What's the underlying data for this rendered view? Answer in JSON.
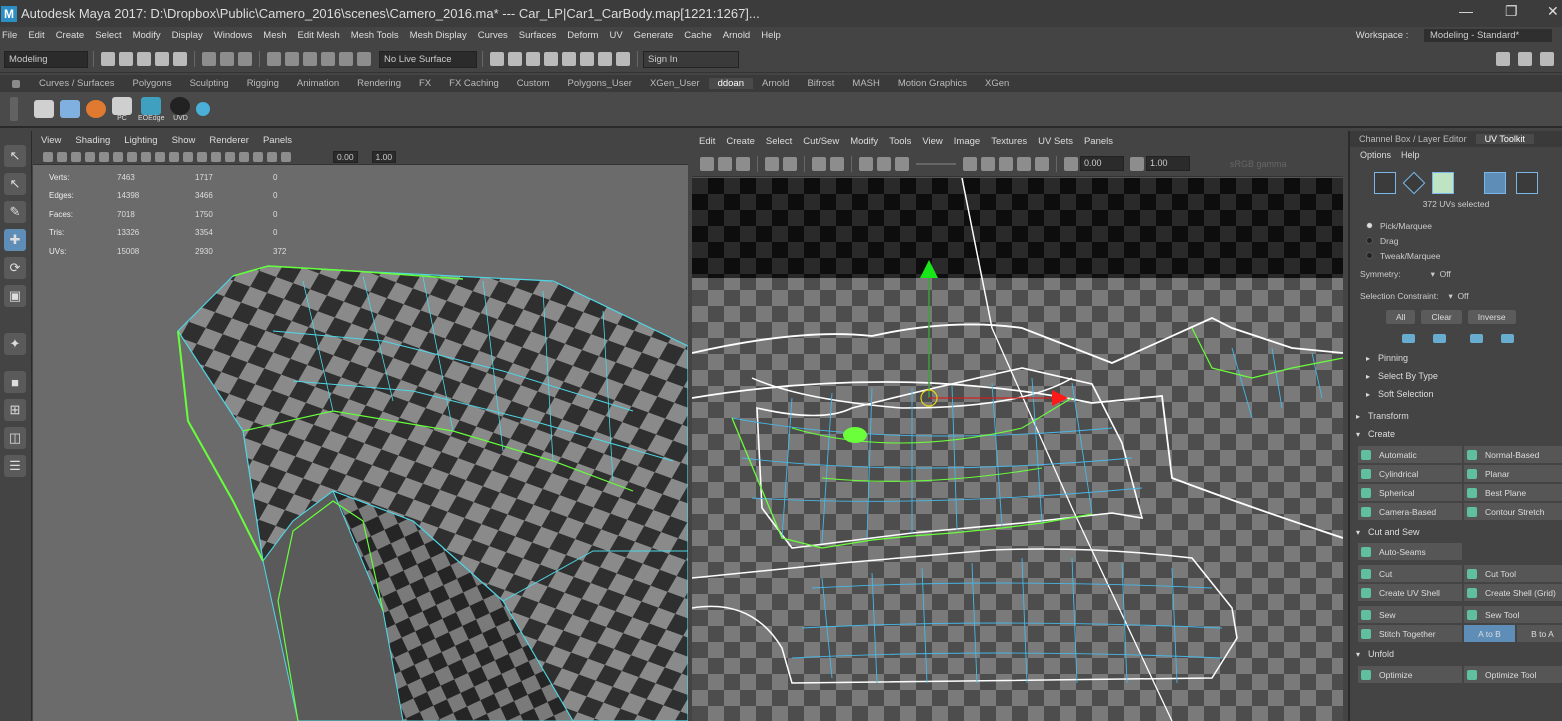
{
  "window": {
    "title": "Autodesk Maya 2017: D:\\Dropbox\\Public\\Camero_2016\\scenes\\Camero_2016.ma*   ---   Car_LP|Car1_CarBody.map[1221:1267]...",
    "logo_letter": "M",
    "minimize": "—",
    "restore": "❐",
    "close": "✕"
  },
  "menu": {
    "items": [
      "File",
      "Edit",
      "Create",
      "Select",
      "Modify",
      "Display",
      "Windows",
      "Mesh",
      "Edit Mesh",
      "Mesh Tools",
      "Mesh Display",
      "Curves",
      "Surfaces",
      "Deform",
      "UV",
      "Generate",
      "Cache",
      "Arnold",
      "Help"
    ],
    "workspace_label": "Workspace :",
    "workspace_value": "Modeling - Standard*"
  },
  "status": {
    "mode": "Modeling",
    "live_surface": "No Live Surface",
    "sign_in": "Sign In"
  },
  "shelf_tabs": [
    "Curves / Surfaces",
    "Polygons",
    "Sculpting",
    "Rigging",
    "Animation",
    "Rendering",
    "FX",
    "FX Caching",
    "Custom",
    "Polygons_User",
    "XGen_User",
    "ddoan",
    "Arnold",
    "Bifrost",
    "MASH",
    "Motion Graphics",
    "XGen"
  ],
  "shelf_active_tab": "ddoan",
  "shelf_buttons": [
    {
      "label": "",
      "color": "#d0d0d0"
    },
    {
      "label": "",
      "color": "#7fb0e0"
    },
    {
      "label": "",
      "color": "#e07a30"
    },
    {
      "label": "PC",
      "color": "#cfcfcf"
    },
    {
      "label": "EOEdge",
      "color": "#3fa0c0"
    },
    {
      "label": "UVD",
      "color": "#222222"
    },
    {
      "label": "",
      "color": "#4ab0d8"
    }
  ],
  "viewport": {
    "menu": [
      "View",
      "Shading",
      "Lighting",
      "Show",
      "Renderer",
      "Panels"
    ],
    "field1": "0.00",
    "field2": "1.00",
    "stats": [
      {
        "label": "Verts:",
        "a": "7463",
        "b": "1717",
        "c": "0"
      },
      {
        "label": "Edges:",
        "a": "14398",
        "b": "3466",
        "c": "0"
      },
      {
        "label": "Faces:",
        "a": "7018",
        "b": "1750",
        "c": "0"
      },
      {
        "label": "Tris:",
        "a": "13326",
        "b": "3354",
        "c": "0"
      },
      {
        "label": "UVs:",
        "a": "15008",
        "b": "2930",
        "c": "372"
      }
    ]
  },
  "uv_editor": {
    "menu": [
      "Edit",
      "Create",
      "Select",
      "Cut/Sew",
      "Modify",
      "Tools",
      "View",
      "Image",
      "Textures",
      "UV Sets",
      "Panels"
    ],
    "field1": "0.00",
    "field2": "1.00",
    "color_space": "sRGB gamma"
  },
  "right_panel": {
    "tabs": [
      "Channel Box / Layer Editor",
      "UV Toolkit"
    ],
    "active_tab": "UV Toolkit",
    "options": [
      "Options",
      "Help"
    ],
    "uvs_selected": "372 UVs selected",
    "pick_modes": [
      {
        "label": "Pick/Marquee",
        "on": true
      },
      {
        "label": "Drag",
        "on": false
      },
      {
        "label": "Tweak/Marquee",
        "on": false
      }
    ],
    "symmetry_label": "Symmetry:",
    "symmetry_value": "Off",
    "constraint_label": "Selection Constraint:",
    "constraint_value": "Off",
    "sel_buttons": [
      "All",
      "Clear",
      "Inverse"
    ],
    "sections_top": [
      "Pinning",
      "Select By Type",
      "Soft Selection"
    ],
    "transform": "Transform",
    "create": "Create",
    "create_tools": [
      "Automatic",
      "Normal-Based",
      "Cylindrical",
      "Planar",
      "Spherical",
      "Best Plane",
      "Camera-Based",
      "Contour Stretch"
    ],
    "cut_and_sew": "Cut and Sew",
    "auto_seams": "Auto-Seams",
    "cut_tools": [
      "Cut",
      "Cut Tool",
      "Create UV Shell",
      "Create Shell (Grid)",
      "Sew",
      "Sew Tool",
      "Stitch Together"
    ],
    "stitch_a": "A to B",
    "stitch_b": "B to A",
    "unfold": "Unfold",
    "unfold_tools": [
      "Optimize",
      "Optimize Tool"
    ]
  }
}
